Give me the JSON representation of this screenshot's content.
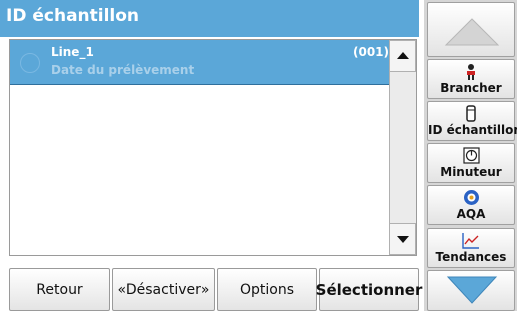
{
  "header": {
    "title": "ID échantillon"
  },
  "list": {
    "items": [
      {
        "name": "Line_1",
        "subtitle": "Date du prélèvement",
        "index": "(001)"
      }
    ]
  },
  "bottom_bar": {
    "back": "Retour",
    "deactivate": "«Désactiver»",
    "options": "Options",
    "select": "Sélectionner"
  },
  "sidebar": {
    "items": [
      {
        "label": "Brancher",
        "icon": "user-icon"
      },
      {
        "label": "ID échantillon",
        "icon": "sample-vial-icon"
      },
      {
        "label": "Minuteur",
        "icon": "timer-icon"
      },
      {
        "label": "AQA",
        "icon": "aqa-icon"
      },
      {
        "label": "Tendances",
        "icon": "trend-chart-icon"
      }
    ]
  },
  "colors": {
    "title_bar": "#5ba7d8",
    "selected_row": "#5ba7d8",
    "nav_arrow": "#5ba7d8"
  }
}
